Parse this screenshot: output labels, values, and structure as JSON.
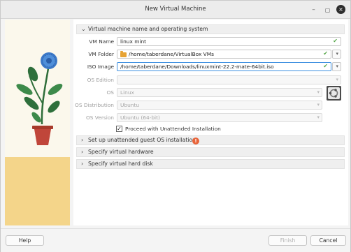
{
  "window": {
    "title": "New Virtual Machine"
  },
  "sections": {
    "vm_name_os": "Virtual machine name and operating system",
    "unattended": "Set up unattended guest OS installation",
    "hardware": "Specify virtual hardware",
    "hard_disk": "Specify virtual hard disk"
  },
  "form": {
    "vm_name_label": "VM Name",
    "vm_name_value": "linux mint",
    "vm_folder_label": "VM Folder",
    "vm_folder_value": "/home/taberdane/VirtualBox VMs",
    "iso_label": "ISO Image",
    "iso_value": "/home/taberdane/Downloads/linuxmint-22.2-mate-64bit.iso",
    "os_edition_label": "OS Edition",
    "os_edition_value": "",
    "os_label": "OS",
    "os_value": "Linux",
    "os_dist_label": "OS Distribution",
    "os_dist_value": "Ubuntu",
    "os_version_label": "OS Version",
    "os_version_value": "Ubuntu (64-bit)",
    "unattended_checkbox_label": "Proceed with Unattended Installation",
    "unattended_checked": true
  },
  "footer": {
    "help": "Help",
    "finish": "Finish",
    "cancel": "Cancel"
  },
  "icons": {
    "check": "check-icon",
    "warning": "warning-icon",
    "folder": "folder-icon",
    "os": "ubuntu-os-icon"
  },
  "colors": {
    "focus_border": "#3d8fe0",
    "valid_check": "#57a84a",
    "warning": "#e8643a",
    "sidebar_yellow": "#f4d58a"
  }
}
